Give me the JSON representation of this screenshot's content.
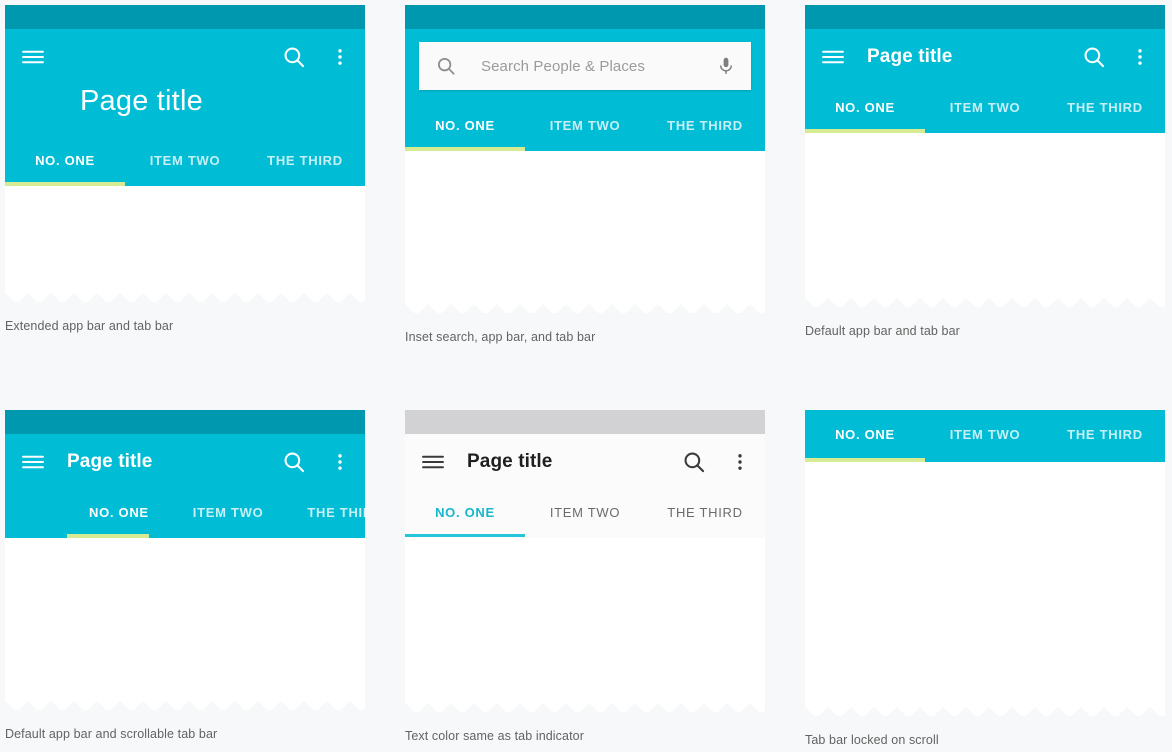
{
  "theme": {
    "app_bar_color": "#00bcd4",
    "status_bar_color": "#0098ae",
    "status_bar_grey": "#d2d2d4",
    "indicator_yellow": "#d7eb93",
    "indicator_teal": "#26c6da",
    "page_background": "#f7f8f9",
    "caption_color": "#636363"
  },
  "tabs": {
    "one": "NO. ONE",
    "two": "ITEM TWO",
    "three": "THE THIRD"
  },
  "common": {
    "page_title": "Page title",
    "menu_icon": "hamburger-menu-icon",
    "search_icon": "search-icon",
    "more_icon": "overflow-menu-icon",
    "mic_icon": "microphone-icon"
  },
  "panels": [
    {
      "id": "extended-app-bar",
      "caption": "Extended app bar and tab bar",
      "title": "Page title",
      "tabs": [
        "NO. ONE",
        "ITEM TWO",
        "THE THIRD"
      ],
      "active_tab": "NO. ONE"
    },
    {
      "id": "inset-search",
      "caption": "Inset search, app bar, and tab bar",
      "search_placeholder": "Search People  & Places",
      "search_value": "",
      "tabs": [
        "NO. ONE",
        "ITEM TWO",
        "THE THIRD"
      ],
      "active_tab": "NO. ONE"
    },
    {
      "id": "default-app-bar",
      "caption": "Default app bar and tab bar",
      "title": "Page title",
      "tabs": [
        "NO. ONE",
        "ITEM TWO",
        "THE THIRD"
      ],
      "active_tab": "NO. ONE"
    },
    {
      "id": "scrollable-tab-bar",
      "caption": "Default app bar and scrollable tab bar",
      "title": "Page title",
      "tabs": [
        "NO. ONE",
        "ITEM TWO",
        "THE THIRD"
      ],
      "active_tab": "NO. ONE"
    },
    {
      "id": "text-color-same-as-indicator",
      "caption": "Text color same as tab indicator",
      "title": "Page title",
      "tabs": [
        "NO. ONE",
        "ITEM TWO",
        "THE THIRD"
      ],
      "active_tab": "NO. ONE"
    },
    {
      "id": "tab-bar-locked-on-scroll",
      "caption": "Tab bar locked on scroll",
      "tabs": [
        "NO. ONE",
        "ITEM TWO",
        "THE THIRD"
      ],
      "active_tab": "NO. ONE"
    }
  ]
}
